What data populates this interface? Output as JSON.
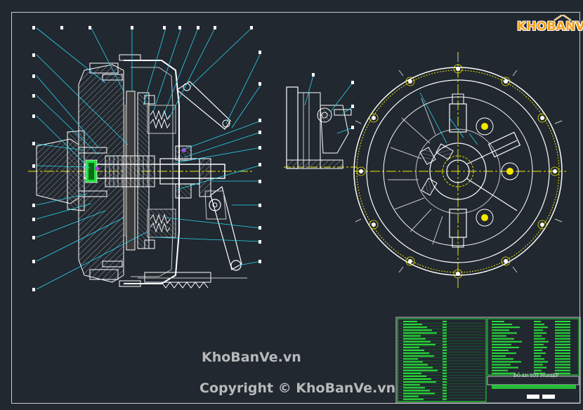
{
  "logo": {
    "text": "KHOBANVE"
  },
  "watermarks": {
    "site": "KhoBanVe.vn",
    "copyright": "Copyright © KhoBanVe.vn"
  },
  "title_block": {
    "title": "ĐỒ ÁN TỐT NGHIỆP"
  },
  "colors": {
    "background": "#212830",
    "outline": "#ffffff",
    "section": "#c8c8c8",
    "leader": "#2ad7f0",
    "centerline": "#f2e600",
    "hatch": "#9a9a9a",
    "green": "#1fe23a",
    "purple": "#b040e0",
    "table": "#28e03a",
    "logo": "#f7a21b"
  }
}
